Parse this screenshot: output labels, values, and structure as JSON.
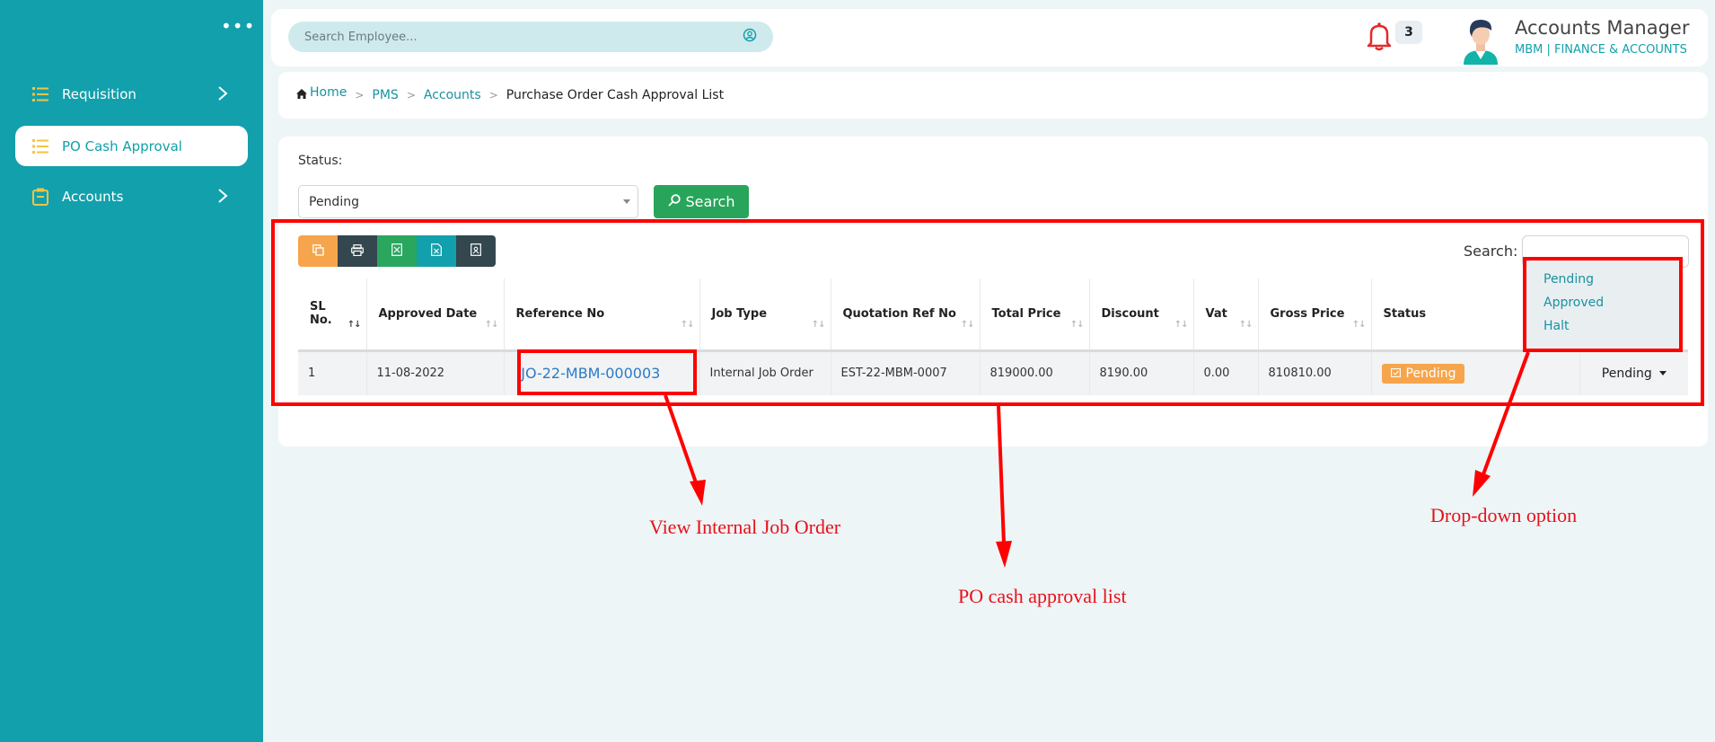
{
  "sidebar": {
    "more_icon": "ellipsis-icon",
    "items": [
      {
        "label": "Requisition",
        "icon": "list-icon",
        "has_chevron": true
      },
      {
        "label": "PO Cash Approval",
        "icon": "list-icon",
        "active": true
      },
      {
        "label": "Accounts",
        "icon": "clipboard-icon",
        "has_chevron": true
      }
    ]
  },
  "header": {
    "search_placeholder": "Search Employee...",
    "notification_count": "3",
    "user_name": "Accounts Manager",
    "user_dept": "MBM  | FINANCE & ACCOUNTS"
  },
  "breadcrumb": {
    "home": "Home",
    "pms": "PMS",
    "accounts": "Accounts",
    "current": "Purchase Order Cash Approval List"
  },
  "filter": {
    "status_label": "Status:",
    "status_value": "Pending",
    "search_button": "Search"
  },
  "table_search_label": "Search:",
  "table": {
    "headers": [
      "SL No.",
      "Approved Date",
      "Reference No",
      "Job Type",
      "Quotation Ref No",
      "Total Price",
      "Discount",
      "Vat",
      "Gross Price",
      "Status",
      ""
    ],
    "rows": [
      {
        "sl": "1",
        "approved_date": "11-08-2022",
        "reference_no": "IJO-22-MBM-000003",
        "job_type": "Internal Job Order",
        "quotation_ref": "EST-22-MBM-0007",
        "total_price": "819000.00",
        "discount": "8190.00",
        "vat": "0.00",
        "gross_price": "810810.00",
        "status": "Pending",
        "action": "Pending"
      }
    ]
  },
  "dropdown_options": [
    "Pending",
    "Approved",
    "Halt"
  ],
  "annotations": {
    "view_job": "View Internal Job Order",
    "list": "PO cash approval list",
    "dropdown": "Drop-down option"
  },
  "colors": {
    "sidebar": "#12a0ac",
    "accent": "#12a0ac",
    "search_button": "#28a55a",
    "pending": "#f6a54c",
    "annotation": "#ff0000"
  }
}
